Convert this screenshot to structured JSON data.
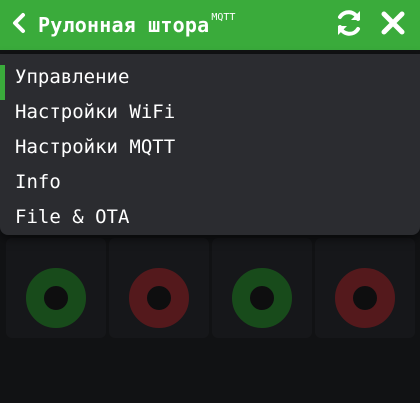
{
  "header": {
    "title": "Рулонная штора",
    "badge": "MQTT",
    "back_icon": "chevron-left-icon",
    "refresh_icon": "refresh-icon",
    "close_icon": "close-icon",
    "accent_color": "#3aab3b"
  },
  "menu": {
    "items": [
      {
        "label": "Управление",
        "active": true
      },
      {
        "label": "Настройки WiFi",
        "active": false
      },
      {
        "label": "Настройки MQTT",
        "active": false
      },
      {
        "label": "Info",
        "active": false
      },
      {
        "label": "File & OTA",
        "active": false
      }
    ]
  },
  "dashboard": {
    "widgets": [
      {
        "label": "",
        "state": "on",
        "color": "#1f7a22"
      },
      {
        "label": "",
        "state": "off",
        "color": "#8c1f24"
      },
      {
        "label": "",
        "state": "on",
        "color": "#1f7a22"
      },
      {
        "label": "",
        "state": "off",
        "color": "#8c1f24"
      }
    ]
  }
}
